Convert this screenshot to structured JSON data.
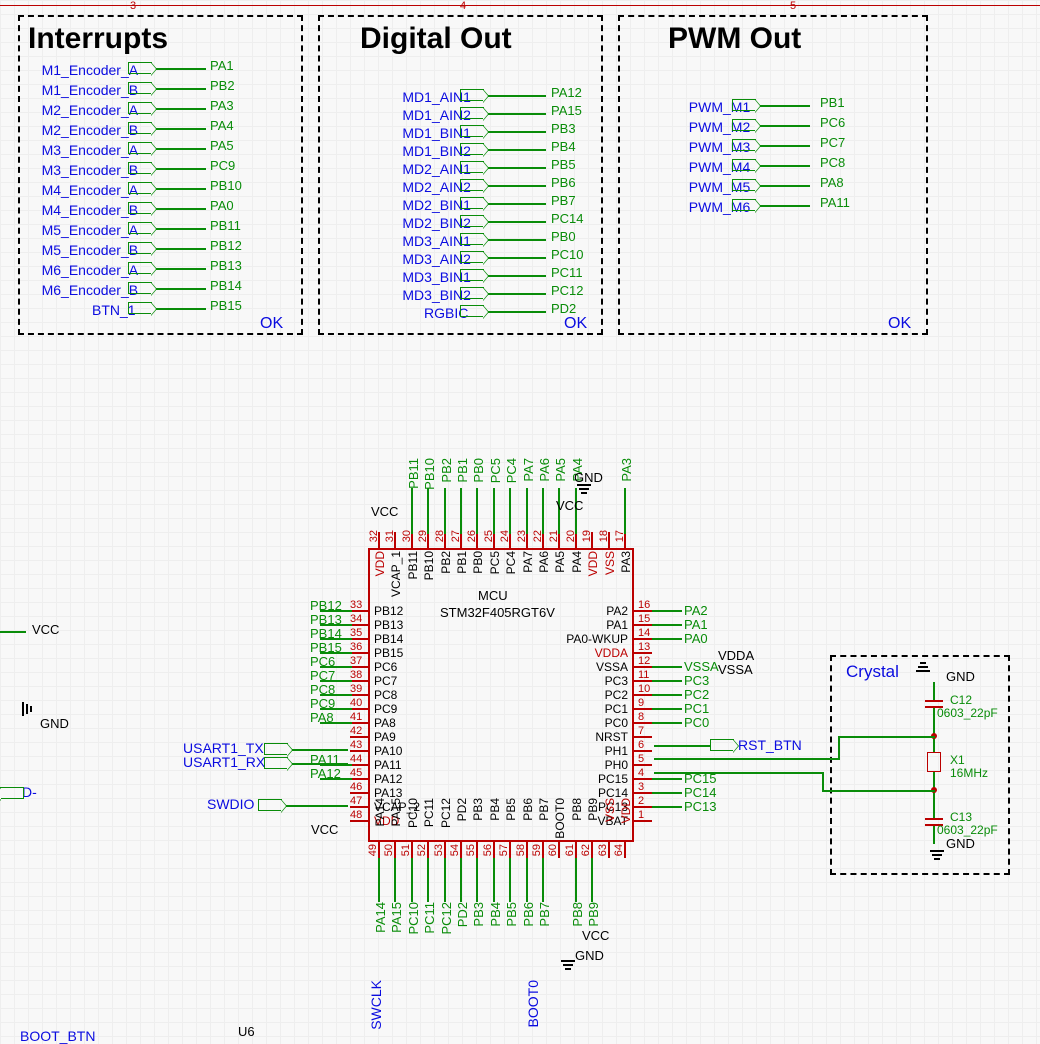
{
  "ruler": [
    "3",
    "4",
    "5"
  ],
  "blocks": {
    "interrupts": {
      "title": "Interrupts",
      "status": "OK",
      "signals": [
        {
          "port": "M1_Encoder_A",
          "net": "PA1"
        },
        {
          "port": "M1_Encoder_B",
          "net": "PB2"
        },
        {
          "port": "M2_Encoder_A",
          "net": "PA3"
        },
        {
          "port": "M2_Encoder_B",
          "net": "PA4"
        },
        {
          "port": "M3_Encoder_A",
          "net": "PA5"
        },
        {
          "port": "M3_Encoder_B",
          "net": "PC9"
        },
        {
          "port": "M4_Encoder_A",
          "net": "PB10"
        },
        {
          "port": "M4_Encoder_B",
          "net": "PA0"
        },
        {
          "port": "M5_Encoder_A",
          "net": "PB11"
        },
        {
          "port": "M5_Encoder_B",
          "net": "PB12"
        },
        {
          "port": "M6_Encoder_A",
          "net": "PB13"
        },
        {
          "port": "M6_Encoder_B",
          "net": "PB14"
        },
        {
          "port": "BTN_1",
          "net": "PB15"
        }
      ]
    },
    "digital_out": {
      "title": "Digital Out",
      "status": "OK",
      "signals": [
        {
          "port": "MD1_AIN1",
          "net": "PA12"
        },
        {
          "port": "MD1_AIN2",
          "net": "PA15"
        },
        {
          "port": "MD1_BIN1",
          "net": "PB3"
        },
        {
          "port": "MD1_BIN2",
          "net": "PB4"
        },
        {
          "port": "MD2_AIN1",
          "net": "PB5"
        },
        {
          "port": "MD2_AIN2",
          "net": "PB6"
        },
        {
          "port": "MD2_BIN1",
          "net": "PB7"
        },
        {
          "port": "MD2_BIN2",
          "net": "PC14"
        },
        {
          "port": "MD3_AIN1",
          "net": "PB0"
        },
        {
          "port": "MD3_AIN2",
          "net": "PC10"
        },
        {
          "port": "MD3_BIN1",
          "net": "PC11"
        },
        {
          "port": "MD3_BIN2",
          "net": "PC12"
        },
        {
          "port": "RGBIC",
          "net": "PD2"
        }
      ]
    },
    "pwm_out": {
      "title": "PWM Out",
      "status": "OK",
      "signals": [
        {
          "port": "PWM_M1",
          "net": "PB1"
        },
        {
          "port": "PWM_M2",
          "net": "PC6"
        },
        {
          "port": "PWM_M3",
          "net": "PC7"
        },
        {
          "port": "PWM_M4",
          "net": "PC8"
        },
        {
          "port": "PWM_M5",
          "net": "PA8"
        },
        {
          "port": "PWM_M6",
          "net": "PA11"
        }
      ]
    }
  },
  "mcu": {
    "designator": "MCU",
    "part": "STM32F405RGT6V",
    "top_pins": [
      {
        "num": "32",
        "name": "VDD",
        "red": true,
        "net": "VCC"
      },
      {
        "num": "31",
        "name": "VCAP_1",
        "net": ""
      },
      {
        "num": "30",
        "name": "PB11",
        "net": "PB11"
      },
      {
        "num": "29",
        "name": "PB10",
        "net": "PB10"
      },
      {
        "num": "28",
        "name": "PB2",
        "net": "PB2"
      },
      {
        "num": "27",
        "name": "PB1",
        "net": "PB1"
      },
      {
        "num": "26",
        "name": "PB0",
        "net": "PB0"
      },
      {
        "num": "25",
        "name": "PC5",
        "net": "PC5"
      },
      {
        "num": "24",
        "name": "PC4",
        "net": "PC4"
      },
      {
        "num": "23",
        "name": "PA7",
        "net": "PA7"
      },
      {
        "num": "22",
        "name": "PA6",
        "net": "PA6"
      },
      {
        "num": "21",
        "name": "PA5",
        "net": "PA5"
      },
      {
        "num": "20",
        "name": "PA4",
        "net": "PA4"
      },
      {
        "num": "19",
        "name": "VDD",
        "red": true,
        "net": "VCC"
      },
      {
        "num": "18",
        "name": "VSS",
        "red": true,
        "net": "GND"
      },
      {
        "num": "17",
        "name": "PA3",
        "net": "PA3"
      }
    ],
    "left_pins": [
      {
        "num": "33",
        "name": "PB12",
        "net": "PB12"
      },
      {
        "num": "34",
        "name": "PB13",
        "net": "PB13"
      },
      {
        "num": "35",
        "name": "PB14",
        "net": "PB14"
      },
      {
        "num": "36",
        "name": "PB15",
        "net": "PB15"
      },
      {
        "num": "37",
        "name": "PC6",
        "net": "PC6"
      },
      {
        "num": "38",
        "name": "PC7",
        "net": "PC7"
      },
      {
        "num": "39",
        "name": "PC8",
        "net": "PC8"
      },
      {
        "num": "40",
        "name": "PC9",
        "net": "PC9"
      },
      {
        "num": "41",
        "name": "PA8",
        "net": "PA8"
      },
      {
        "num": "42",
        "name": "PA9"
      },
      {
        "num": "43",
        "name": "PA10"
      },
      {
        "num": "44",
        "name": "PA11",
        "net": "PA11"
      },
      {
        "num": "45",
        "name": "PA12",
        "net": "PA12"
      },
      {
        "num": "46",
        "name": "PA13"
      },
      {
        "num": "47",
        "name": "VCAP_2"
      },
      {
        "num": "48",
        "name": "VDD",
        "red": true,
        "net": "VCC"
      }
    ],
    "right_pins": [
      {
        "num": "16",
        "name": "PA2",
        "net": "PA2"
      },
      {
        "num": "15",
        "name": "PA1",
        "net": "PA1"
      },
      {
        "num": "14",
        "name": "PA0-WKUP",
        "net": "PA0"
      },
      {
        "num": "13",
        "name": "VDDA",
        "red": true,
        "net": "VDDA"
      },
      {
        "num": "12",
        "name": "VSSA",
        "net": "VSSA"
      },
      {
        "num": "11",
        "name": "PC3",
        "net": "PC3"
      },
      {
        "num": "10",
        "name": "PC2",
        "net": "PC2"
      },
      {
        "num": "9",
        "name": "PC1",
        "net": "PC1"
      },
      {
        "num": "8",
        "name": "PC0",
        "net": "PC0"
      },
      {
        "num": "7",
        "name": "NRST"
      },
      {
        "num": "6",
        "name": "PH1"
      },
      {
        "num": "5",
        "name": "PH0"
      },
      {
        "num": "4",
        "name": "PC15",
        "net": "PC15"
      },
      {
        "num": "3",
        "name": "PC14",
        "net": "PC14"
      },
      {
        "num": "2",
        "name": "PC13",
        "net": "PC13"
      },
      {
        "num": "1",
        "name": "VBAT"
      }
    ],
    "bottom_pins": [
      {
        "num": "49",
        "name": "PA14",
        "net": "PA14"
      },
      {
        "num": "50",
        "name": "PA15",
        "net": "PA15"
      },
      {
        "num": "51",
        "name": "PC10",
        "net": "PC10"
      },
      {
        "num": "52",
        "name": "PC11",
        "net": "PC11"
      },
      {
        "num": "53",
        "name": "PC12",
        "net": "PC12"
      },
      {
        "num": "54",
        "name": "PD2",
        "net": "PD2"
      },
      {
        "num": "55",
        "name": "PB3",
        "net": "PB3"
      },
      {
        "num": "56",
        "name": "PB4",
        "net": "PB4"
      },
      {
        "num": "57",
        "name": "PB5",
        "net": "PB5"
      },
      {
        "num": "58",
        "name": "PB6",
        "net": "PB6"
      },
      {
        "num": "59",
        "name": "PB7",
        "net": "PB7"
      },
      {
        "num": "60",
        "name": "BOOT0"
      },
      {
        "num": "61",
        "name": "PB8",
        "net": "PB8"
      },
      {
        "num": "62",
        "name": "PB9",
        "net": "PB9"
      },
      {
        "num": "63",
        "name": "VSS",
        "red": true,
        "net": "GND"
      },
      {
        "num": "64",
        "name": "VDD",
        "red": true,
        "net": "VCC"
      }
    ],
    "left_ports": [
      {
        "label": "USART1_TX"
      },
      {
        "label": "USART1_RX"
      },
      {
        "label": "SWDIO"
      }
    ],
    "right_ports": [
      {
        "label": "RST_BTN"
      }
    ],
    "bottom_ports": [
      {
        "label": "SWCLK"
      },
      {
        "label": "BOOT0"
      }
    ],
    "power": {
      "vcc": "VCC",
      "gnd": "GND",
      "vdda": "VDDA",
      "vssa": "VSSA"
    }
  },
  "crystal": {
    "title": "Crystal",
    "c12": {
      "ref": "C12",
      "value": "0603_22pF"
    },
    "c13": {
      "ref": "C13",
      "value": "0603_22pF"
    },
    "x1": {
      "ref": "X1",
      "value": "16MHz"
    },
    "gnd": "GND"
  },
  "frag_left": {
    "vcc": "VCC",
    "gnd": "GND",
    "dminus": "D-"
  },
  "frag_bottom": {
    "boot_btn": "BOOT_BTN",
    "u6": "U6"
  }
}
